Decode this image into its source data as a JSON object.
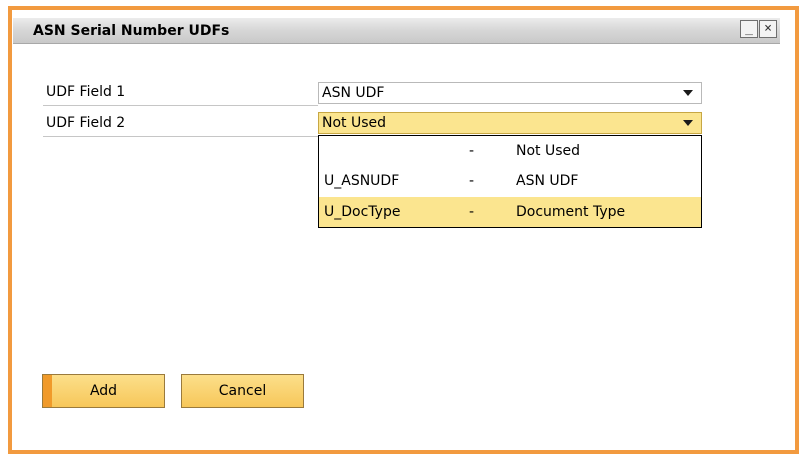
{
  "window": {
    "title": "ASN Serial Number UDFs",
    "minimize_glyph": "_",
    "close_glyph": "×"
  },
  "fields": [
    {
      "label": "UDF Field 1",
      "value": "ASN UDF"
    },
    {
      "label": "UDF Field 2",
      "value": "Not Used"
    }
  ],
  "dropdown": {
    "options": [
      {
        "code": "",
        "sep": "-",
        "desc": "Not Used"
      },
      {
        "code": "U_ASNUDF",
        "sep": "-",
        "desc": "ASN UDF"
      },
      {
        "code": "U_DocType",
        "sep": "-",
        "desc": "Document Type"
      }
    ],
    "highlighted_index": 2
  },
  "buttons": {
    "add_label": "Add",
    "cancel_label": "Cancel"
  },
  "colors": {
    "frame_accent": "#f29a3f",
    "active_field": "#fbe58f",
    "button_fill": "#f7c75a"
  }
}
